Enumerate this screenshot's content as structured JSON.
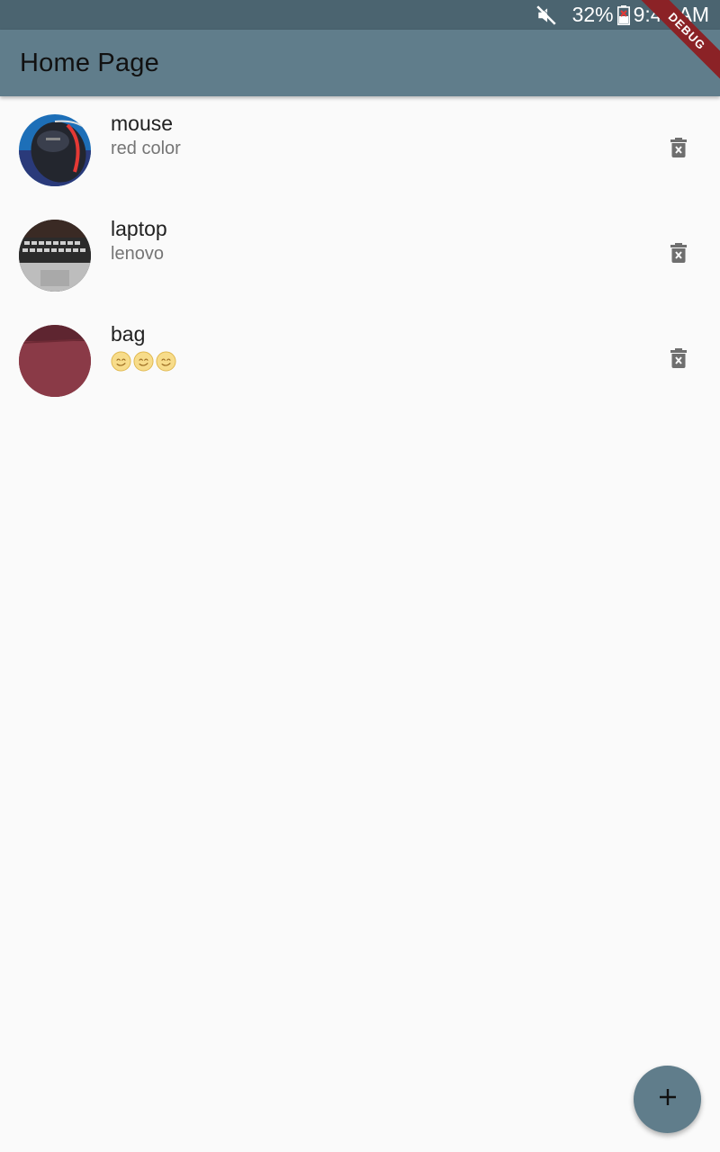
{
  "status_bar": {
    "battery_percent": "32%",
    "time": "9:44 AM",
    "icons": [
      "mute-icon",
      "battery-icon"
    ]
  },
  "debug_banner": {
    "label": "DEBUG"
  },
  "app_bar": {
    "title": "Home Page",
    "color": "#607d8b"
  },
  "items": [
    {
      "title": "mouse",
      "subtitle": "red color",
      "avatar": "mouse-photo",
      "action_icon": "delete-icon"
    },
    {
      "title": "laptop",
      "subtitle": "lenovo",
      "avatar": "laptop-photo",
      "action_icon": "delete-icon"
    },
    {
      "title": "bag",
      "subtitle_emojis": [
        "smiley-emoji",
        "smiley-emoji",
        "smiley-emoji"
      ],
      "avatar": "bag-photo",
      "action_icon": "delete-icon"
    }
  ],
  "fab": {
    "icon": "add-icon"
  },
  "colors": {
    "status_bar": "#4b6470",
    "app_bar": "#607d8b",
    "background": "#fafafa",
    "delete_icon": "#6f6f6f"
  }
}
